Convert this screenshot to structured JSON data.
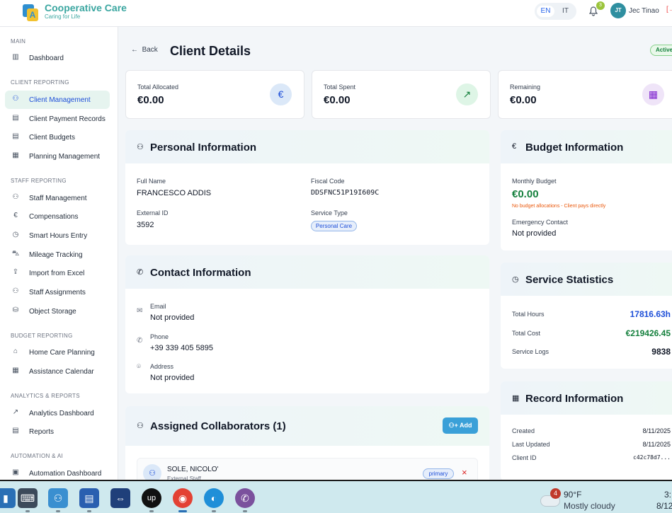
{
  "app": {
    "name": "Cooperative Care",
    "tagline": "Caring for Life",
    "logo_letter": "A"
  },
  "header": {
    "lang_en": "EN",
    "lang_it": "IT",
    "notifications_count": "3",
    "user_initials": "JT",
    "user_name": "Jec Tinao"
  },
  "sidebar": {
    "main_title": "MAIN",
    "main_items": [
      {
        "label": "Dashboard",
        "icon": "bar-chart-icon"
      }
    ],
    "client_title": "CLIENT REPORTING",
    "client_items": [
      {
        "label": "Client Management",
        "icon": "users-icon"
      },
      {
        "label": "Client Payment Records",
        "icon": "file-icon"
      },
      {
        "label": "Client Budgets",
        "icon": "file-icon"
      },
      {
        "label": "Planning Management",
        "icon": "calendar-icon"
      }
    ],
    "staff_title": "STAFF REPORTING",
    "staff_items": [
      {
        "label": "Staff Management",
        "icon": "user-cog-icon"
      },
      {
        "label": "Compensations",
        "icon": "euro-icon"
      },
      {
        "label": "Smart Hours Entry",
        "icon": "clock-icon"
      },
      {
        "label": "Mileage Tracking",
        "icon": "car-icon"
      },
      {
        "label": "Import from Excel",
        "icon": "upload-icon"
      },
      {
        "label": "Staff Assignments",
        "icon": "user-check-icon"
      },
      {
        "label": "Object Storage",
        "icon": "database-icon"
      }
    ],
    "budget_title": "BUDGET REPORTING",
    "budget_items": [
      {
        "label": "Home Care Planning",
        "icon": "home-icon"
      },
      {
        "label": "Assistance Calendar",
        "icon": "calendar-icon"
      }
    ],
    "analytics_title": "ANALYTICS & REPORTS",
    "analytics_items": [
      {
        "label": "Analytics Dashboard",
        "icon": "trend-icon"
      },
      {
        "label": "Reports",
        "icon": "file-icon"
      }
    ],
    "automation_title": "AUTOMATION & AI",
    "automation_items": [
      {
        "label": "Automation Dashboard",
        "icon": "bot-icon"
      }
    ]
  },
  "page": {
    "back_label": "Back",
    "title": "Client Details",
    "status": "Active"
  },
  "stats": [
    {
      "label": "Total Allocated",
      "value": "€0.00",
      "icon": "euro-icon"
    },
    {
      "label": "Total Spent",
      "value": "€0.00",
      "icon": "trend-up-icon"
    },
    {
      "label": "Remaining",
      "value": "€0.00",
      "icon": "calculator-icon"
    }
  ],
  "personal": {
    "title": "Personal Information",
    "full_name_label": "Full Name",
    "full_name": "FRANCESCO ADDIS",
    "fiscal_code_label": "Fiscal Code",
    "fiscal_code": "DDSFNC51P19I609C",
    "external_id_label": "External ID",
    "external_id": "3592",
    "service_type_label": "Service Type",
    "service_type": "Personal Care"
  },
  "contact": {
    "title": "Contact Information",
    "email_label": "Email",
    "email": "Not provided",
    "phone_label": "Phone",
    "phone": "+39 339 405 5895",
    "address_label": "Address",
    "address": "Not provided"
  },
  "collaborators": {
    "title": "Assigned Collaborators (1)",
    "add_label": "Add",
    "items": [
      {
        "name": "SOLE, NICOLO'",
        "role": "External Staff",
        "badge": "primary",
        "remove": "×"
      }
    ]
  },
  "budget": {
    "title": "Budget Information",
    "monthly_label": "Monthly Budget",
    "monthly_value": "€0.00",
    "note": "No budget allocations - Client pays directly",
    "emergency_label": "Emergency Contact",
    "emergency_value": "Not provided"
  },
  "service_stats": {
    "title": "Service Statistics",
    "hours_label": "Total Hours",
    "hours_value": "17816.63h",
    "cost_label": "Total Cost",
    "cost_value": "€219426.45",
    "logs_label": "Service Logs",
    "logs_value": "9838"
  },
  "record": {
    "title": "Record Information",
    "created_label": "Created",
    "created": "8/11/2025",
    "updated_label": "Last Updated",
    "updated": "8/11/2025",
    "client_id_label": "Client ID",
    "client_id": "c42c78d7..."
  },
  "taskbar": {
    "weather_badge": "4",
    "temperature": "90°F",
    "condition": "Mostly cloudy",
    "time": "3:",
    "date": "8/12"
  },
  "colors": {
    "accent": "#3aa6a0",
    "active_nav": "#e6f4ef",
    "blue_value": "#1d4ed8",
    "green_value": "#15803d"
  }
}
